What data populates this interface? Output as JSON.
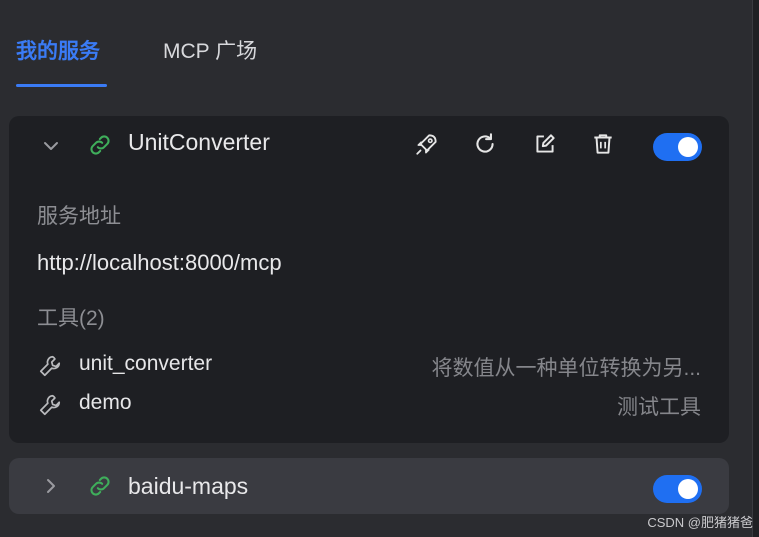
{
  "tabs": [
    {
      "label": "我的服务",
      "active": true
    },
    {
      "label": "MCP 广场",
      "active": false
    }
  ],
  "services": [
    {
      "name": "UnitConverter",
      "expanded": true,
      "enabled": true,
      "address_label": "服务地址",
      "address": "http://localhost:8000/mcp",
      "tools_label": "工具(2)",
      "tools": [
        {
          "name": "unit_converter",
          "description": "将数值从一种单位转换为另..."
        },
        {
          "name": "demo",
          "description": "测试工具"
        }
      ],
      "actions": [
        "rocket-icon",
        "refresh-icon",
        "edit-icon",
        "trash-icon"
      ]
    },
    {
      "name": "baidu-maps",
      "expanded": false,
      "enabled": true
    }
  ],
  "colors": {
    "accent": "#3a7bf5",
    "toggle_on": "#1f6ff2",
    "link_icon": "#3fae5b"
  },
  "watermark": "CSDN @肥猪猪爸"
}
